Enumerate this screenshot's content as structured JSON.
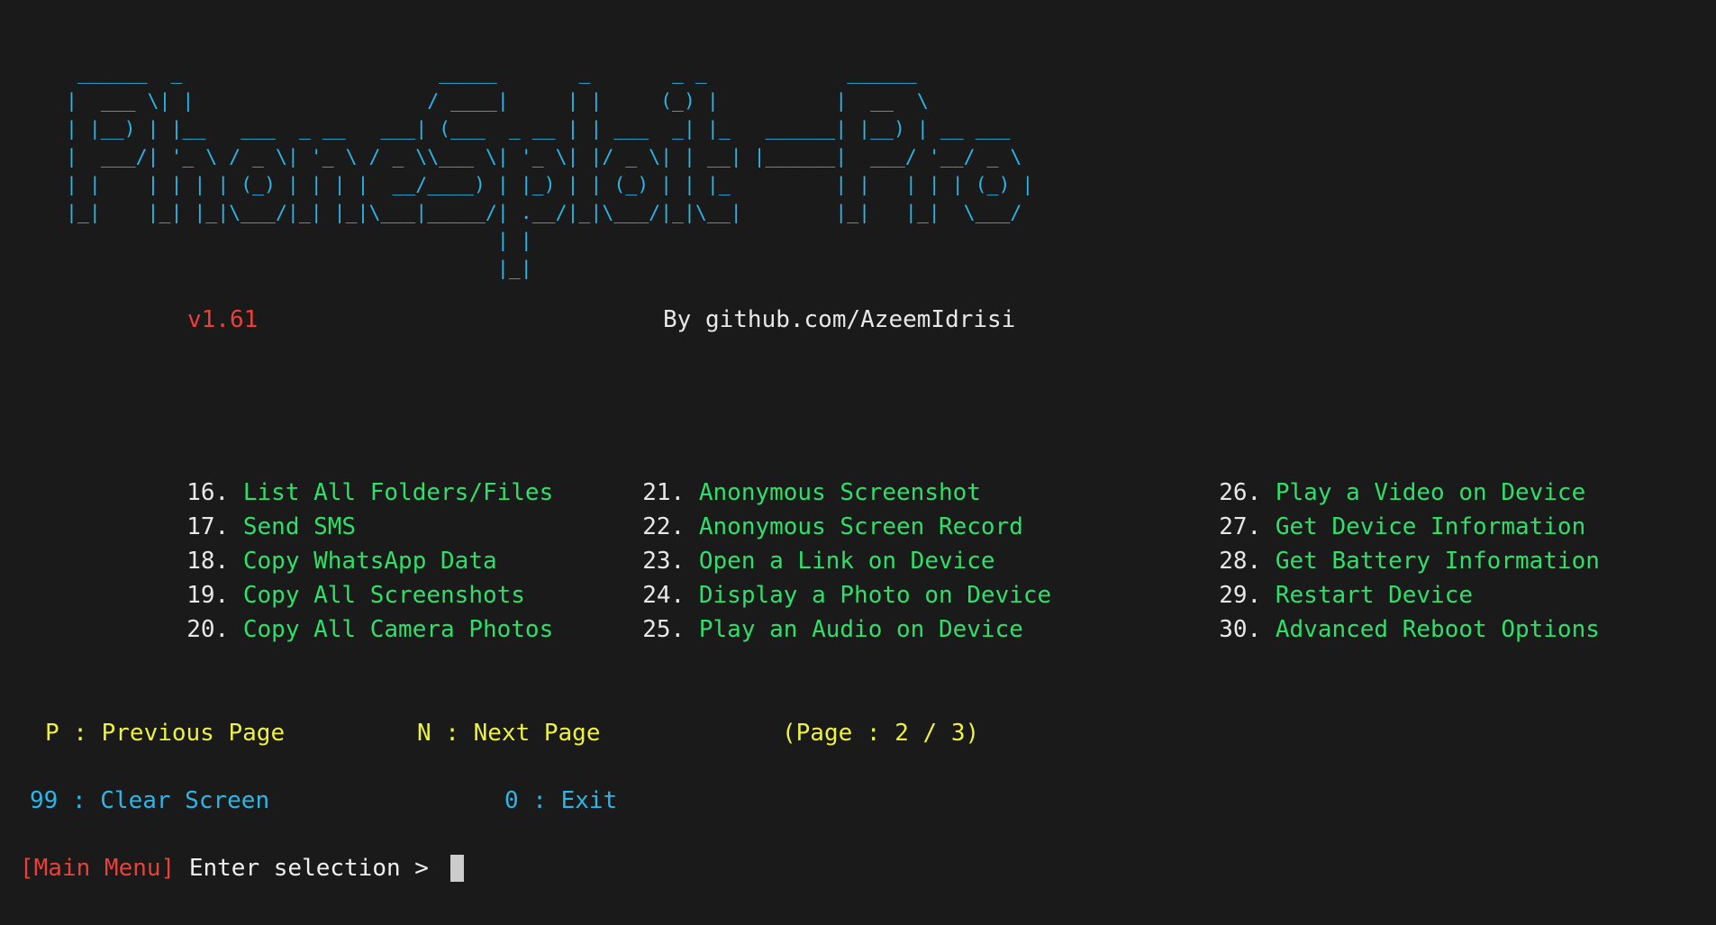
{
  "app": {
    "name": "PhoneSploit Pro",
    "banner_ascii": "  ______  _                      _____       _       _ _            ______            \n |  ___ \\| |                    / ____|     | |     (_) |          |  __  \\           \n | |__) | |__   ___  _ __   ___| (___  _ __ | | ___  _| |_   ______| |__) | __ ___   \n |  ___/| '_ \\ / _ \\| '_ \\ / _ \\\\___ \\| '_ \\| |/ _ \\| | __| |______|  ___/ '__/ _ \\  \n | |    | | | | (_) | | | |  __/____) | |_) | | (_) | | |_         | |   | | | (_) | \n |_|    |_| |_|\\___/|_| |_|\\___|_____/| .__/|_|\\___/|_|\\__|        |_|   |_|  \\___/  \n                                      | |                                            \n                                      |_|                                            ",
    "version": "v1.61",
    "author": "By github.com/AzeemIdrisi"
  },
  "colors": {
    "background": "#1a1a1a",
    "banner": "#29b6e8",
    "version": "#e8413a",
    "author": "#e8e8e8",
    "menu_number": "#e8e8e8",
    "menu_label": "#2ee06a",
    "navigation": "#eef23d",
    "utility": "#29b6e8",
    "prompt_context": "#e8413a",
    "prompt_text": "#f0f0f0",
    "cursor": "#cccccc"
  },
  "menu": {
    "columns": [
      {
        "items": [
          {
            "number": "16.",
            "label": "List All Folders/Files"
          },
          {
            "number": "17.",
            "label": "Send SMS"
          },
          {
            "number": "18.",
            "label": "Copy WhatsApp Data"
          },
          {
            "number": "19.",
            "label": "Copy All Screenshots"
          },
          {
            "number": "20.",
            "label": "Copy All Camera Photos"
          }
        ]
      },
      {
        "items": [
          {
            "number": "21.",
            "label": "Anonymous Screenshot"
          },
          {
            "number": "22.",
            "label": "Anonymous Screen Record"
          },
          {
            "number": "23.",
            "label": "Open a Link on Device"
          },
          {
            "number": "24.",
            "label": "Display a Photo on Device"
          },
          {
            "number": "25.",
            "label": "Play an Audio on Device"
          }
        ]
      },
      {
        "items": [
          {
            "number": "26.",
            "label": "Play a Video on Device"
          },
          {
            "number": "27.",
            "label": "Get Device Information"
          },
          {
            "number": "28.",
            "label": "Get Battery Information"
          },
          {
            "number": "29.",
            "label": "Restart Device"
          },
          {
            "number": "30.",
            "label": "Advanced Reboot Options"
          }
        ]
      }
    ]
  },
  "navigation": {
    "previous": "P : Previous Page",
    "next": "N : Next Page",
    "page_indicator": "(Page : 2 / 3)",
    "current_page": 2,
    "total_pages": 3
  },
  "utility": {
    "clear_screen": "99 : Clear Screen",
    "exit": "0 : Exit"
  },
  "prompt": {
    "context": "[Main Menu]",
    "text": " Enter selection > ",
    "value": ""
  }
}
